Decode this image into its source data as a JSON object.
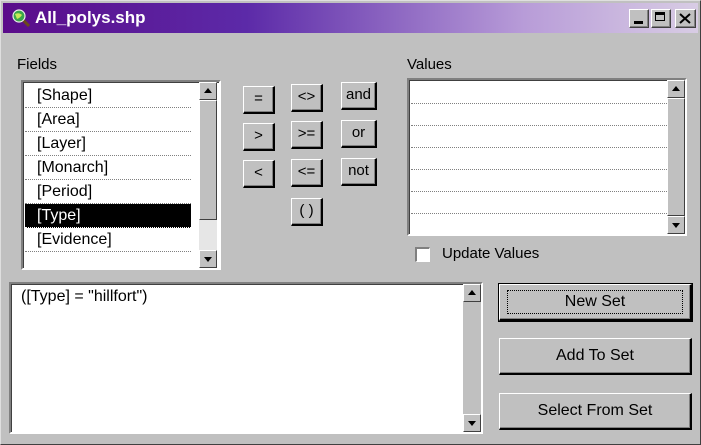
{
  "window": {
    "title": "All_polys.shp",
    "title_bar_color": "#5a0c8a"
  },
  "fields": {
    "label": "Fields",
    "items": [
      "[Shape]",
      "[Area]",
      "[Layer]",
      "[Monarch]",
      "[Period]",
      "[Type]",
      "[Evidence]"
    ],
    "selected_index": 5
  },
  "operators": {
    "eq": "=",
    "ne": "<>",
    "and": "and",
    "gt": ">",
    "ge": ">=",
    "or": "or",
    "lt": "<",
    "le": "<=",
    "not": "not",
    "parens": "( )"
  },
  "values": {
    "label": "Values",
    "update_label": "Update Values",
    "update_checked": false
  },
  "expression": {
    "value": "([Type] = \"hillfort\")"
  },
  "actions": {
    "new_set": "New Set",
    "add_to_set": "Add To Set",
    "select_from_set": "Select From Set"
  }
}
